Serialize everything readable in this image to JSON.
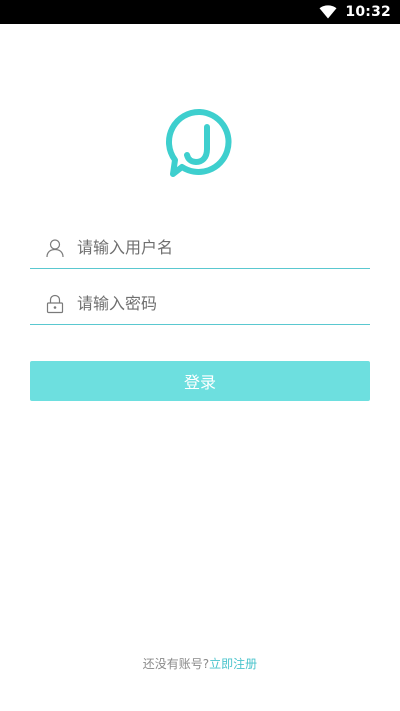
{
  "status_bar": {
    "time": "10:32",
    "icons": [
      "wifi-icon"
    ]
  },
  "logo": {
    "letter": "J",
    "color": "#3ecfce"
  },
  "login_form": {
    "username_placeholder": "请输入用户名",
    "username_value": "",
    "password_placeholder": "请输入密码",
    "password_value": "",
    "submit_label": "登录"
  },
  "footer": {
    "prompt": "还没有账号?",
    "register_link": "立即注册"
  },
  "colors": {
    "accent": "#6ddfdf",
    "link": "#4ac4cc",
    "underline": "#5ac8d0"
  }
}
